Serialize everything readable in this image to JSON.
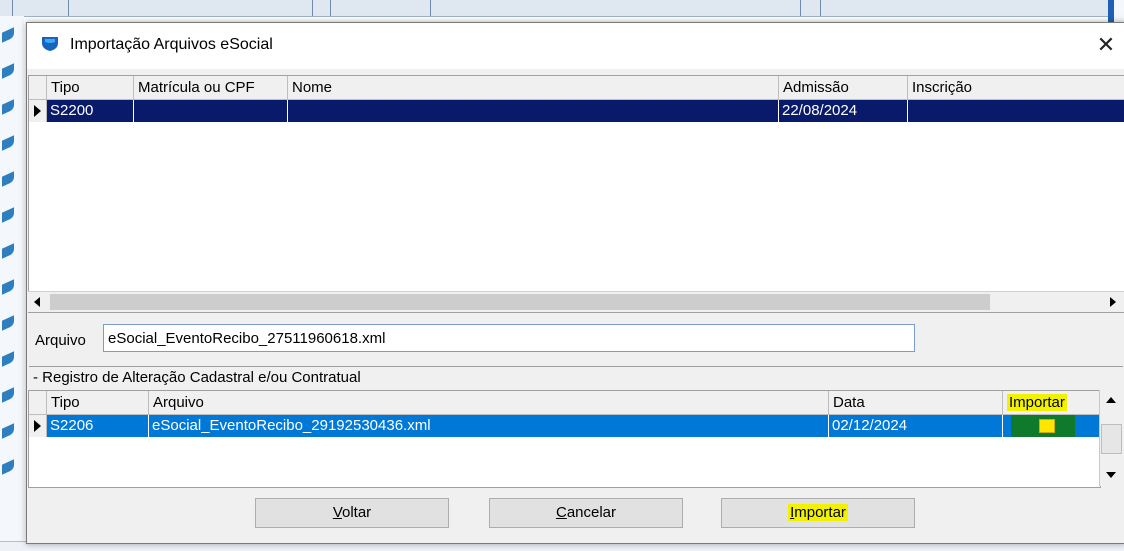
{
  "dialog": {
    "title": "Importação Arquivos eSocial",
    "close_glyph": "✕"
  },
  "grid1": {
    "columns": [
      "Tipo",
      "Matrícula ou CPF",
      "Nome",
      "Admissão",
      "Inscrição"
    ],
    "rows": [
      {
        "tipo": "S2200",
        "matricula": "",
        "nome": "",
        "admissao": "22/08/2024",
        "inscricao": ""
      }
    ]
  },
  "arquivo": {
    "label": "Arquivo",
    "value": "eSocial_EventoRecibo_27511960618.xml"
  },
  "section_title": "- Registro de Alteração Cadastral e/ou Contratual",
  "grid2": {
    "columns": [
      "Tipo",
      "Arquivo",
      "Data",
      "Importar"
    ],
    "rows": [
      {
        "tipo": "S2206",
        "arquivo": "eSocial_EventoRecibo_29192530436.xml",
        "data": "02/12/2024",
        "importar": true
      }
    ]
  },
  "buttons": {
    "voltar": {
      "accel": "V",
      "rest": "oltar"
    },
    "cancelar": {
      "accel": "C",
      "rest": "ancelar"
    },
    "importar": {
      "accel": "I",
      "rest": "mportar"
    }
  },
  "colors": {
    "selected_row_navy": "#0a1a6b",
    "selected_row_blue": "#0078d7",
    "highlight": "#f2f200"
  }
}
